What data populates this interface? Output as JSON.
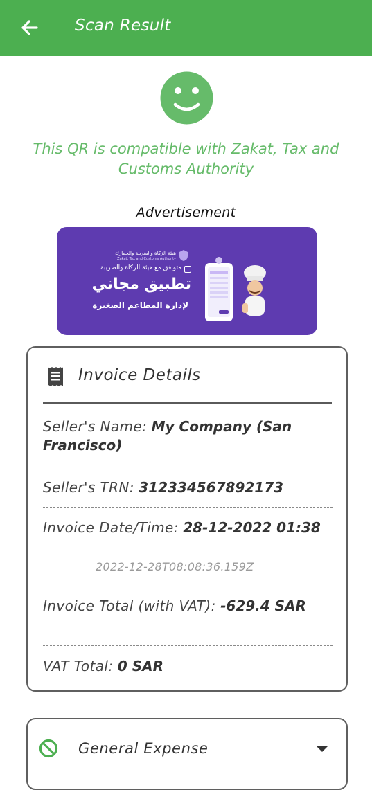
{
  "appbar": {
    "title": "Scan Result",
    "back_icon": "arrow-left-icon",
    "color": "#4caf50"
  },
  "status": {
    "icon": "smiley-icon",
    "message": "This QR is compatible with Zakat, Tax and Customs Authority",
    "color": "#66bb6a"
  },
  "advertisement": {
    "label": "Advertisement",
    "banner": {
      "logo_ar": "هيئة الزكاة والضريبة والجمارك",
      "logo_en": "Zakat, Tax and Customs Authority",
      "line1": "متوافق مع هيئة الزكاة والضريبة",
      "line2": "تطبيق مجاني",
      "line3": "لإدارة المطاعم الصغيرة",
      "background": "#5e3bb0"
    }
  },
  "invoice": {
    "title": "Invoice Details",
    "icon": "receipt-icon",
    "seller_name_label": "Seller's Name:",
    "seller_name_value": "My Company (San Francisco)",
    "seller_trn_label": "Seller's TRN:",
    "seller_trn_value": "312334567892173",
    "date_label": "Invoice Date/Time:",
    "date_value": "28-12-2022 01:38",
    "date_iso": "2022-12-28T08:08:36.159Z",
    "total_label": "Invoice Total (with VAT):",
    "total_value": "-629.4 SAR",
    "vat_label": "VAT Total:",
    "vat_value": "0 SAR"
  },
  "expense": {
    "icon": "block-icon",
    "label": "General Expense",
    "dropdown_icon": "caret-down-icon"
  }
}
